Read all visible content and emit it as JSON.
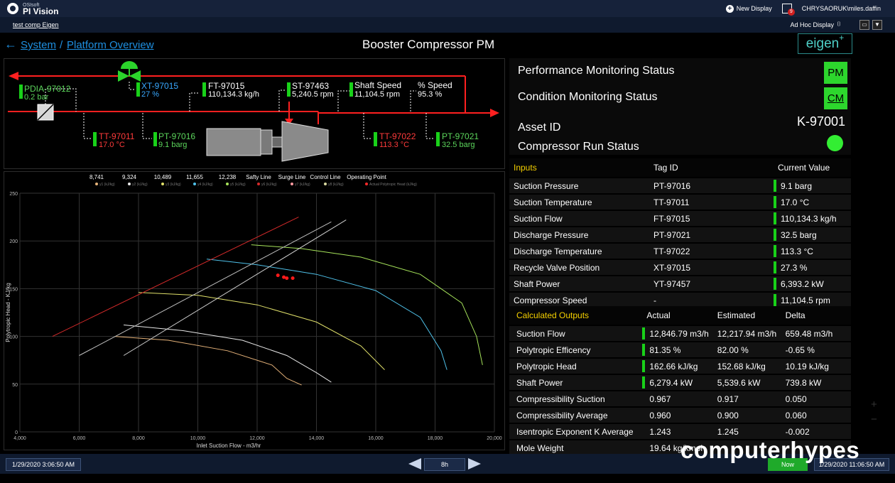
{
  "app": {
    "brand_sub": "OSIsoft",
    "brand_name": "PI Vision",
    "new_display": "New Display",
    "alert_count": "9",
    "user": "CHRYSAORUK\\miles.daffin",
    "link": "test comp Eigen",
    "adhoc": "Ad Hoc Display",
    "dropdown_glyph": "▼"
  },
  "breadcrumb": {
    "system": "System",
    "sep": "/",
    "platform": "Platform Overview"
  },
  "title": "Booster Compressor PM",
  "logo": {
    "text": "eigen",
    "sup": "+"
  },
  "pid": {
    "pdia": {
      "tag": "PDIA-97012",
      "value": "0.2 bar"
    },
    "xt": {
      "tag": "XT-97015",
      "value": "27 %"
    },
    "ft": {
      "tag": "FT-97015",
      "value": "110,134.3 kg/h"
    },
    "st": {
      "tag": "ST-97463",
      "value": "5,240.5 rpm"
    },
    "shaft": {
      "tag": "Shaft Speed",
      "value": "11,104.5 rpm"
    },
    "pct": {
      "tag": "% Speed",
      "value": "95.3 %"
    },
    "tt1": {
      "tag": "TT-97011",
      "value": "17.0 °C"
    },
    "pt1": {
      "tag": "PT-97016",
      "value": "9.1 barg"
    },
    "tt2": {
      "tag": "TT-97022",
      "value": "113.3 °C"
    },
    "pt2": {
      "tag": "PT-97021",
      "value": "32.5 barg"
    }
  },
  "chart_data": {
    "type": "line",
    "title": "",
    "xlabel": "Inlet Suction Flow - m3/hr",
    "ylabel": "Polytropic Head - KJ/kg",
    "xlim": [
      4000,
      20000
    ],
    "ylim": [
      0,
      250
    ],
    "x_ticks": [
      "4,000",
      "6,000",
      "8,000",
      "10,000",
      "12,000",
      "14,000",
      "16,000",
      "18,000",
      "20,000"
    ],
    "y_ticks": [
      "250",
      "200",
      "150",
      "100",
      "50",
      "0"
    ],
    "grid": true,
    "legend_position": "top",
    "legend_titles": [
      "8,741",
      "9,324",
      "10,489",
      "11,655",
      "12,238",
      "Safty Line",
      "Surge Line",
      "Control Line",
      "Operating Point"
    ],
    "legend_items": [
      "y1 (kJ/kg)",
      "y2 (kJ/kg)",
      "y3 (kJ/kg)",
      "y4 (kJ/kg)",
      "y5 (kJ/kg)",
      "y6 (kJ/kg)",
      "y7 (kJ/kg)",
      "y8 (kJ/kg)",
      "Actual Polytropic Head (kJ/kg)"
    ],
    "series": [
      {
        "color": "#e6b37a",
        "points": [
          [
            7.2,
            100
          ],
          [
            9,
            96
          ],
          [
            11,
            85
          ],
          [
            12.5,
            70
          ],
          [
            13,
            56
          ],
          [
            13.5,
            49
          ]
        ]
      },
      {
        "color": "#e8e8e8",
        "points": [
          [
            7.5,
            112
          ],
          [
            9.5,
            106
          ],
          [
            11.5,
            96
          ],
          [
            13,
            80
          ],
          [
            14,
            62
          ],
          [
            14.5,
            52
          ]
        ]
      },
      {
        "color": "#e0e06a",
        "points": [
          [
            8,
            146
          ],
          [
            10,
            143
          ],
          [
            12,
            133
          ],
          [
            14,
            115
          ],
          [
            15.5,
            90
          ],
          [
            16.3,
            65
          ]
        ]
      },
      {
        "color": "#4fc1e9",
        "points": [
          [
            10.3,
            181
          ],
          [
            12,
            175
          ],
          [
            14,
            165
          ],
          [
            16,
            148
          ],
          [
            17.5,
            120
          ],
          [
            18.2,
            85
          ],
          [
            18.4,
            65
          ]
        ]
      },
      {
        "color": "#a6e35a",
        "points": [
          [
            11.8,
            196
          ],
          [
            13.5,
            192
          ],
          [
            15.5,
            183
          ],
          [
            17.5,
            165
          ],
          [
            18.9,
            135
          ],
          [
            19.4,
            100
          ],
          [
            19.6,
            70
          ]
        ]
      },
      {
        "color": "#d42a2a",
        "points": [
          [
            5.1,
            100
          ],
          [
            13.4,
            225
          ]
        ]
      },
      {
        "color": "#bfbfbf",
        "points": [
          [
            6,
            80
          ],
          [
            14.5,
            220
          ]
        ]
      },
      {
        "color": "#d0d0d0",
        "points": [
          [
            7.5,
            80
          ],
          [
            15,
            222
          ]
        ]
      }
    ],
    "operating_points": [
      [
        12.7,
        164
      ],
      [
        12.9,
        162
      ],
      [
        13.0,
        161
      ],
      [
        13.2,
        161
      ]
    ]
  },
  "status": {
    "pm_label": "Performance Monitoring Status",
    "pm_box": "PM",
    "cm_label": "Condition Monitoring Status",
    "cm_box": "CM",
    "asset_label": "Asset ID",
    "asset_value": "K-97001",
    "run_label": "Compressor Run Status"
  },
  "inputs": {
    "title": "Inputs",
    "col_tag": "Tag ID",
    "col_val": "Current Value",
    "rows": [
      {
        "name": "Suction Pressure",
        "tag": "PT-97016",
        "value": "9.1 barg"
      },
      {
        "name": "Suction Temperature",
        "tag": "TT-97011",
        "value": "17.0 °C"
      },
      {
        "name": "Suction Flow",
        "tag": "FT-97015",
        "value": "110,134.3 kg/h"
      },
      {
        "name": "Discharge Pressure",
        "tag": "PT-97021",
        "value": "32.5 barg"
      },
      {
        "name": "Discharge Temperature",
        "tag": "TT-97022",
        "value": "113.3 °C"
      },
      {
        "name": "Recycle Valve Position",
        "tag": "XT-97015",
        "value": "27.3 %"
      },
      {
        "name": "Shaft Power",
        "tag": "YT-97457",
        "value": "6,393.2 kW"
      },
      {
        "name": "Compressor Speed",
        "tag": "-",
        "value": "11,104.5 rpm"
      }
    ]
  },
  "outputs": {
    "title": "Calculated Outputs",
    "col_actual": "Actual",
    "col_est": "Estimated",
    "col_delta": "Delta",
    "rows": [
      {
        "name": "Suction Flow",
        "actual": "12,846.79 m3/h",
        "est": "12,217.94 m3/h",
        "delta": "659.48 m3/h"
      },
      {
        "name": "Polytropic Efficency",
        "actual": "81.35 %",
        "est": "82.00 %",
        "delta": "-0.65 %"
      },
      {
        "name": "Polytropic Head",
        "actual": "162.66 kJ/kg",
        "est": "152.68 kJ/kg",
        "delta": "10.19 kJ/kg"
      },
      {
        "name": "Shaft Power",
        "actual": "6,279.4 kW",
        "est": "5,539.6 kW",
        "delta": "739.8 kW"
      },
      {
        "name": "Compressibility Suction",
        "actual": "0.967",
        "est": "0.917",
        "delta": "0.050"
      },
      {
        "name": "Compressibility Average",
        "actual": "0.960",
        "est": "0.900",
        "delta": "0.060"
      },
      {
        "name": "Isentropic Exponent K Average",
        "actual": "1.243",
        "est": "1.245",
        "delta": "-0.002"
      },
      {
        "name": "Mole Weight",
        "actual": "19.64 kg/kmol",
        "est": "",
        "delta": ""
      }
    ]
  },
  "timebar": {
    "start": "1/29/2020 3:06:50 AM",
    "duration": "8h",
    "now": "Now",
    "end": "1/29/2020 11:06:50 AM"
  },
  "watermark": "computerhypes"
}
